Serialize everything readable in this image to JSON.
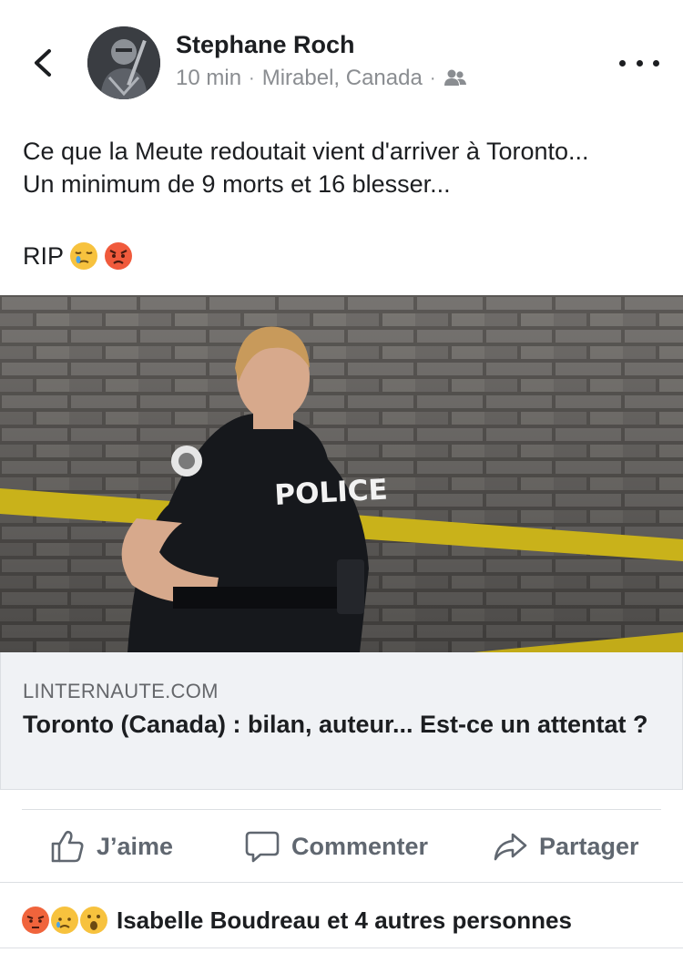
{
  "post": {
    "author": "Stephane Roch",
    "time": "10 min",
    "location": "Mirabel, Canada",
    "audience_icon": "friends-icon",
    "text_lines": [
      "Ce que la Meute redoutait vient d'arriver à Toronto...",
      "Un minimum de 9 morts et 16 blesser..."
    ],
    "rip_text": "RIP",
    "emojis": [
      "sleepy-face-icon",
      "angry-face-icon"
    ]
  },
  "link": {
    "image_text": "POLICE",
    "domain": "LINTERNAUTE.COM",
    "title": "Toronto (Canada) : bilan, auteur... Est-ce un attentat ?"
  },
  "actions": {
    "like": "J’aime",
    "comment": "Commenter",
    "share": "Partager"
  },
  "reactions": {
    "summary": "Isabelle Boudreau et 4 autres personnes",
    "icons": [
      "angry-reaction-icon",
      "sad-reaction-icon",
      "wow-reaction-icon"
    ]
  },
  "colors": {
    "text": "#1c1e21",
    "muted": "#8a8d91",
    "action": "#606770",
    "link_bg": "#f0f2f5"
  }
}
